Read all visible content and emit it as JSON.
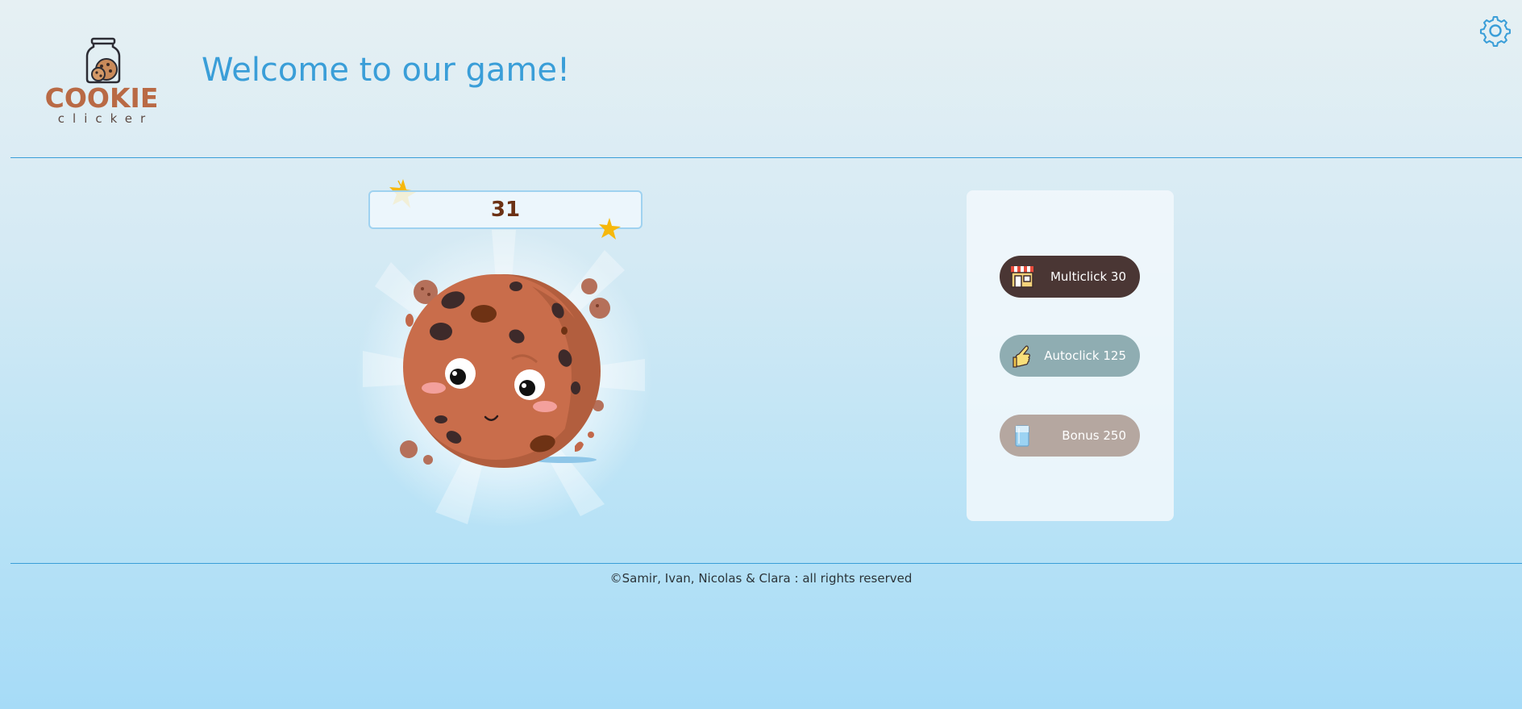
{
  "header": {
    "logo": {
      "word": "COOKIE",
      "sub": "clicker"
    },
    "welcome_title": "Welcome to our game!",
    "settings_icon": "gear-icon"
  },
  "game": {
    "score": "31",
    "cookie_icon": "cookie-character"
  },
  "shop": {
    "items": [
      {
        "label": "Multiclick 30",
        "icon": "shop-stall-icon",
        "state": "enabled"
      },
      {
        "label": "Autoclick 125",
        "icon": "pointing-hand-icon",
        "state": "disabled"
      },
      {
        "label": "Bonus 250",
        "icon": "milk-glass-icon",
        "state": "disabled"
      }
    ]
  },
  "footer": {
    "text": "©Samir, Ivan, Nicolas & Clara : all rights reserved"
  },
  "colors": {
    "accent": "#3a9ed8",
    "score_text": "#6b3114",
    "multiclick_bg": "#4a3634",
    "autoclick_bg": "#8fadb2",
    "bonus_bg": "#b5a7a0",
    "cookie": "#c2684a"
  }
}
